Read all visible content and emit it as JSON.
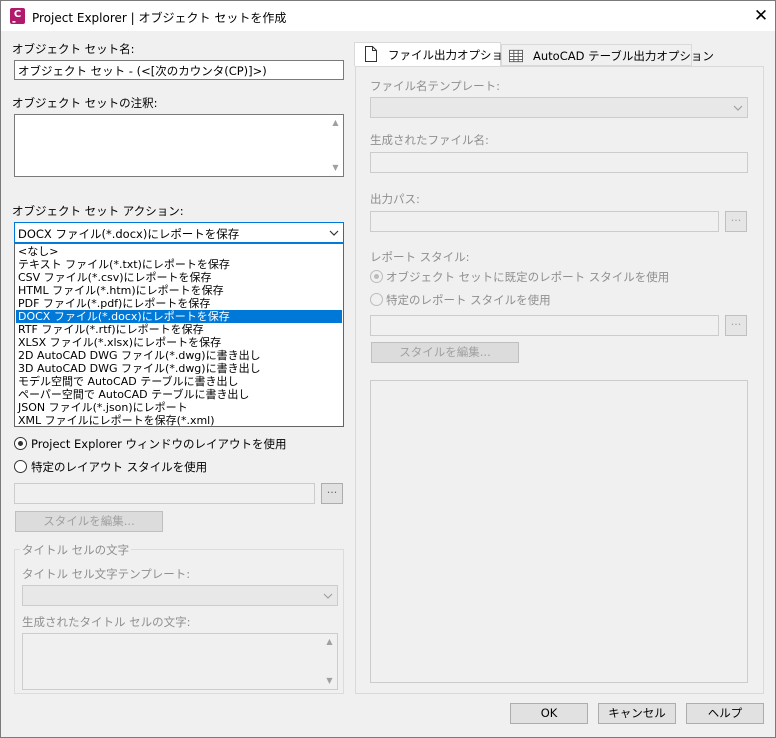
{
  "window": {
    "title": "Project Explorer | オブジェクト セットを作成",
    "app_icon_letter": "C",
    "close_symbol": "✕"
  },
  "left": {
    "name_label": "オブジェクト セット名:",
    "name_value": "オブジェクト セット - (<[次のカウンタ(CP)]>)",
    "note_label": "オブジェクト セットの注釈:",
    "note_value": "",
    "action_label": "オブジェクト セット アクション:",
    "action_selected": "DOCX ファイル(*.docx)にレポートを保存",
    "action_options": [
      "<なし>",
      "テキスト ファイル(*.txt)にレポートを保存",
      "CSV ファイル(*.csv)にレポートを保存",
      "HTML ファイル(*.htm)にレポートを保存",
      "PDF ファイル(*.pdf)にレポートを保存",
      "DOCX ファイル(*.docx)にレポートを保存",
      "RTF ファイル(*.rtf)にレポートを保存",
      "XLSX ファイル(*.xlsx)にレポートを保存",
      "2D AutoCAD DWG ファイル(*.dwg)に書き出し",
      "3D AutoCAD DWG ファイル(*.dwg)に書き出し",
      "モデル空間で AutoCAD テーブルに書き出し",
      "ペーパー空間で AutoCAD テーブルに書き出し",
      "JSON ファイル(*.json)にレポート",
      "XML ファイルにレポートを保存(*.xml)"
    ],
    "selected_index": 5,
    "layout_radio_1": "Project Explorer ウィンドウのレイアウトを使用",
    "layout_radio_2": "特定のレイアウト スタイルを使用",
    "layout_path_value": "",
    "dots_label": "···",
    "edit_style_button": "スタイルを編集...",
    "title_group_label": "タイトル セルの文字",
    "title_template_label": "タイトル セル文字テンプレート:",
    "title_generated_label": "生成されたタイトル セルの文字:"
  },
  "tabs": [
    {
      "label": "ファイル出力オプション",
      "icon": "document-icon",
      "active": true
    },
    {
      "label": "AutoCAD テーブル出力オプション",
      "icon": "table-icon",
      "active": false
    }
  ],
  "right": {
    "filename_template_label": "ファイル名テンプレート:",
    "generated_filename_label": "生成されたファイル名:",
    "output_path_label": "出力パス:",
    "report_style_label": "レポート スタイル:",
    "report_radio_1": "オブジェクト セットに既定のレポート スタイルを使用",
    "report_radio_2": "特定のレポート スタイルを使用",
    "edit_style_button": "スタイルを編集..."
  },
  "footer": {
    "ok": "OK",
    "cancel": "キャンセル",
    "help": "ヘルプ"
  },
  "colors": {
    "selection": "#0078d7",
    "app_icon": "#b0196c",
    "disabled_text": "#8f8f8f"
  }
}
